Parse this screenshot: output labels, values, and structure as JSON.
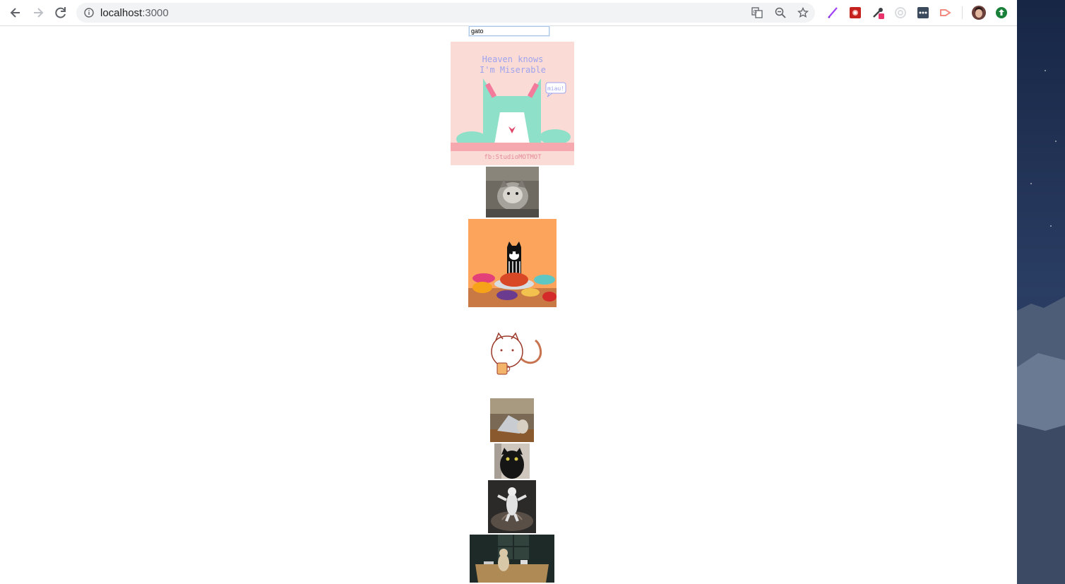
{
  "browser": {
    "url_host": "localhost",
    "url_port": ":3000",
    "icons": [
      "back-icon",
      "forward-icon",
      "reload-icon",
      "info-icon",
      "translate-icon",
      "zoom-icon",
      "star-icon"
    ],
    "extensions": [
      "quill-extension-icon",
      "photo-extension-icon",
      "eyedropper-extension-icon",
      "circle-extension-icon",
      "dots-extension-icon",
      "arrow-extension-icon",
      "profile-avatar",
      "update-icon"
    ]
  },
  "search": {
    "value": "gato"
  },
  "gifs": [
    {
      "name": "heaven-knows-cat-gif",
      "caption_line1": "Heaven knows",
      "caption_line2": "I'm Miserable",
      "bubble": "miau!",
      "footer": "fb:StudioMOTMOT"
    },
    {
      "name": "gray-cat-gif"
    },
    {
      "name": "black-cat-feast-gif"
    },
    {
      "name": "sketch-cat-coffee-gif"
    },
    {
      "name": "cat-laptop-gif"
    },
    {
      "name": "black-cat-gif"
    },
    {
      "name": "dancing-white-cat-gif"
    },
    {
      "name": "cat-on-table-gif"
    }
  ],
  "colors": {
    "chrome_bg": "#ffffff",
    "omnibox_bg": "#f1f3f4",
    "search_border": "#a9c7e8"
  }
}
